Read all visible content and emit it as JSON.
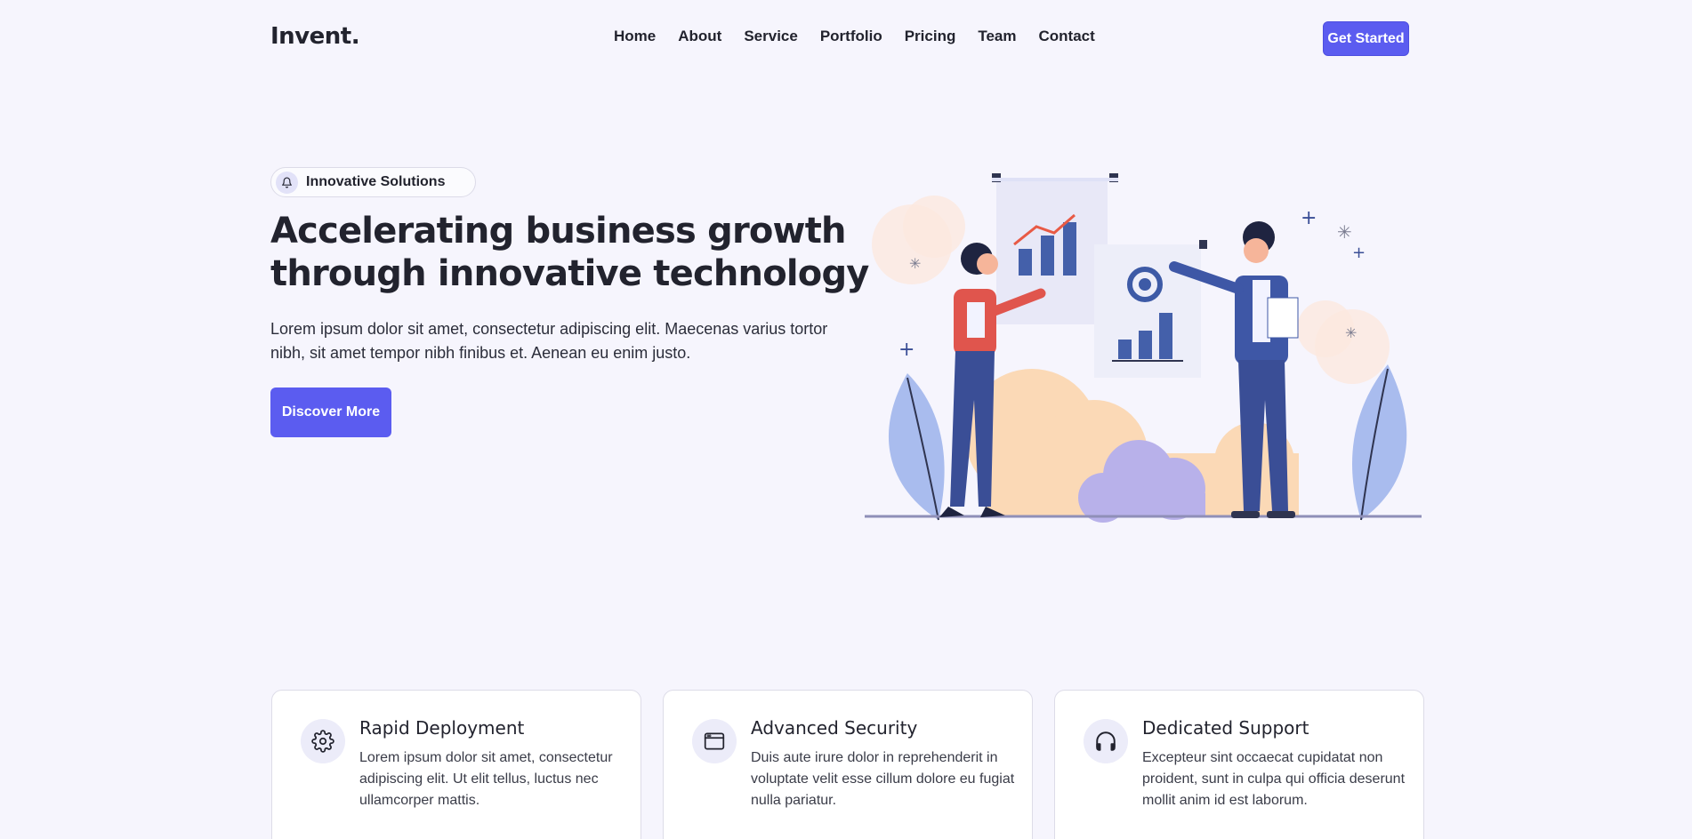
{
  "header": {
    "logo": "Invent.",
    "nav": [
      {
        "label": "Home"
      },
      {
        "label": "About"
      },
      {
        "label": "Service"
      },
      {
        "label": "Portfolio"
      },
      {
        "label": "Pricing"
      },
      {
        "label": "Team"
      },
      {
        "label": "Contact"
      }
    ],
    "cta_label": "Get Started"
  },
  "hero": {
    "badge_icon": "bell-icon",
    "badge_text": "Innovative Solutions",
    "title": "Accelerating business growth through innovative technology",
    "description": "Lorem ipsum dolor sit amet, consectetur adipiscing elit. Maecenas varius tortor nibh, sit amet tempor nibh finibus et. Aenean eu enim justo.",
    "button_label": "Discover More"
  },
  "features": [
    {
      "icon": "gear-icon",
      "title": "Rapid Deployment",
      "text": "Lorem ipsum dolor sit amet, consectetur adipiscing elit. Ut elit tellus, luctus nec ullamcorper mattis."
    },
    {
      "icon": "browser-window-icon",
      "title": "Advanced Security",
      "text": "Duis aute irure dolor in reprehenderit in voluptate velit esse cillum dolore eu fugiat nulla pariatur."
    },
    {
      "icon": "headset-icon",
      "title": "Dedicated Support",
      "text": "Excepteur sint occaecat cupidatat non proident, sunt in culpa qui officia deserunt mollit anim id est laborum."
    }
  ],
  "colors": {
    "accent": "#5b5cf0",
    "background": "#f6f5fd",
    "text": "#22232e"
  }
}
